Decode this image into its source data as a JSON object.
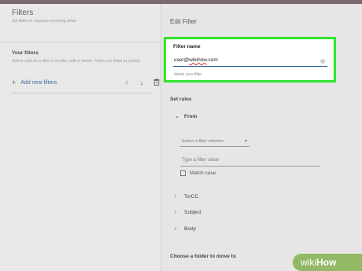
{
  "left": {
    "title": "Filters",
    "subtitle": "Set filters to organize incoming email",
    "your_filters": "Your filters",
    "your_filters_desc": "Add or click on a filter to reorder, edit or delete. Filters are listed by priority",
    "add_label": "Add new filters",
    "tools": {
      "up": "↑",
      "down": "↓",
      "delete": "🗑"
    }
  },
  "right": {
    "title": "Edit Filter",
    "filter_name": {
      "label": "Filter name",
      "value_prefix": "user@",
      "value_squiggle": "wikihow",
      "value_suffix": ".com",
      "helper": "Name your filter"
    },
    "set_rules": "Set rules",
    "from": "From",
    "select_criterion": "Select a filter criterion",
    "filter_value_placeholder": "Type a filter value",
    "match_case": "Match case",
    "to_cc": "To/CC",
    "subject": "Subject",
    "body": "Body",
    "move_folder": "Choose a folder to move to"
  },
  "watermark": {
    "part1": "wiki",
    "part2": "How"
  },
  "colors": {
    "highlight": "#2ee52e",
    "accent": "#2b5fa3",
    "watermark": "#93b866"
  }
}
